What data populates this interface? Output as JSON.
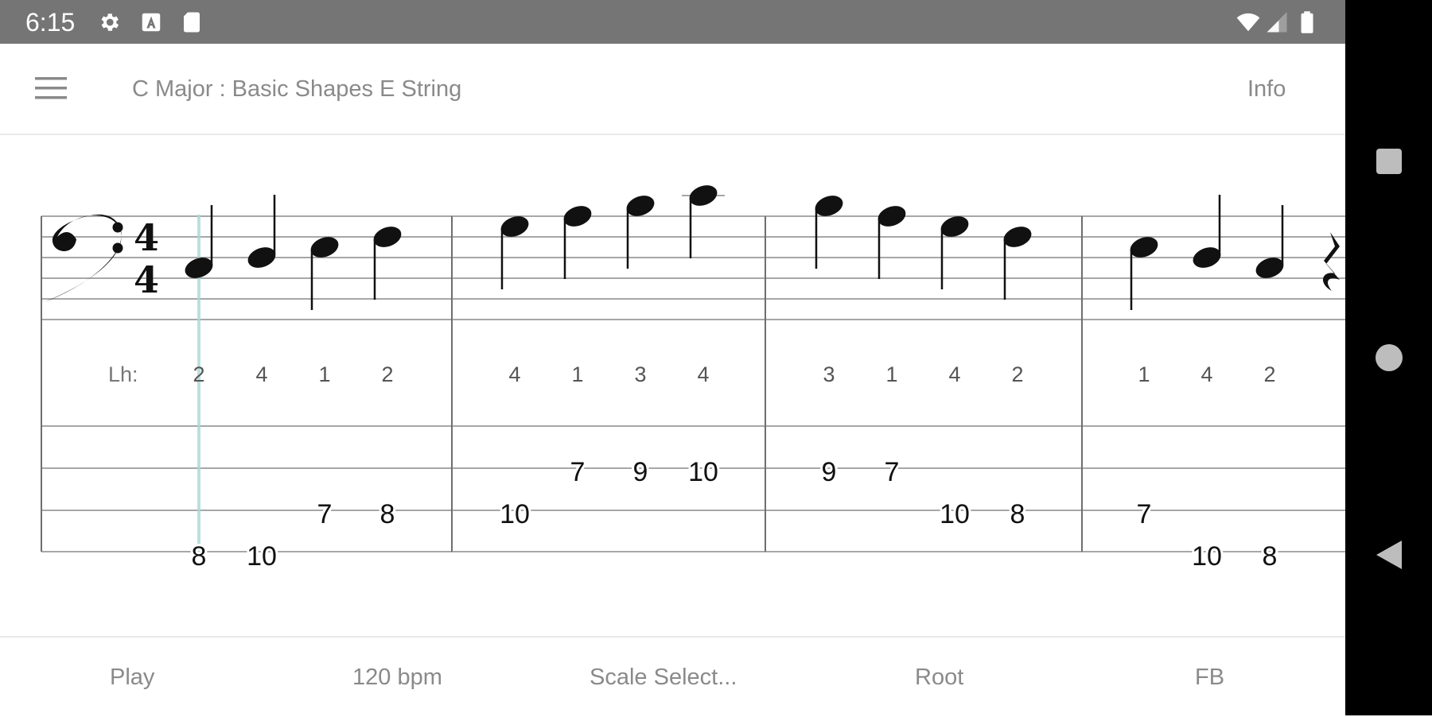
{
  "status_bar": {
    "time": "6:15",
    "left_icons": [
      "gear-icon",
      "a-notification-icon",
      "sd-card-icon"
    ],
    "right_icons": [
      "wifi-icon",
      "cell-signal-icon",
      "battery-icon"
    ],
    "background": "#757575"
  },
  "app_bar": {
    "menu_icon": "hamburger-icon",
    "title": "C Major : Basic Shapes E String",
    "info_label": "Info"
  },
  "score": {
    "time_signature": {
      "top": "4",
      "bottom": "4"
    },
    "lh_label": "Lh:",
    "playhead_color": "#a8d8d8",
    "measures": [
      {
        "fingering": [
          "2",
          "4",
          "1",
          "2"
        ],
        "tab": [
          {
            "string": 4,
            "fret": "8"
          },
          {
            "string": 4,
            "fret": "10"
          },
          {
            "string": 3,
            "fret": "7"
          },
          {
            "string": 3,
            "fret": "8"
          }
        ]
      },
      {
        "fingering": [
          "4",
          "1",
          "3",
          "4"
        ],
        "tab": [
          {
            "string": 3,
            "fret": "10"
          },
          {
            "string": 2,
            "fret": "7"
          },
          {
            "string": 2,
            "fret": "9"
          },
          {
            "string": 2,
            "fret": "10"
          }
        ]
      },
      {
        "fingering": [
          "3",
          "1",
          "4",
          "2"
        ],
        "tab": [
          {
            "string": 2,
            "fret": "9"
          },
          {
            "string": 2,
            "fret": "7"
          },
          {
            "string": 3,
            "fret": "10"
          },
          {
            "string": 3,
            "fret": "8"
          }
        ]
      },
      {
        "fingering": [
          "1",
          "4",
          "2"
        ],
        "tab": [
          {
            "string": 3,
            "fret": "7"
          },
          {
            "string": 4,
            "fret": "10"
          },
          {
            "string": 4,
            "fret": "8"
          }
        ]
      }
    ]
  },
  "bottom_bar": {
    "play": "Play",
    "tempo": "120 bpm",
    "scale_select": "Scale Select...",
    "root": "Root",
    "fb": "FB"
  },
  "nav_bar": {
    "buttons": [
      "recents-square-icon",
      "home-circle-icon",
      "back-triangle-icon"
    ]
  }
}
